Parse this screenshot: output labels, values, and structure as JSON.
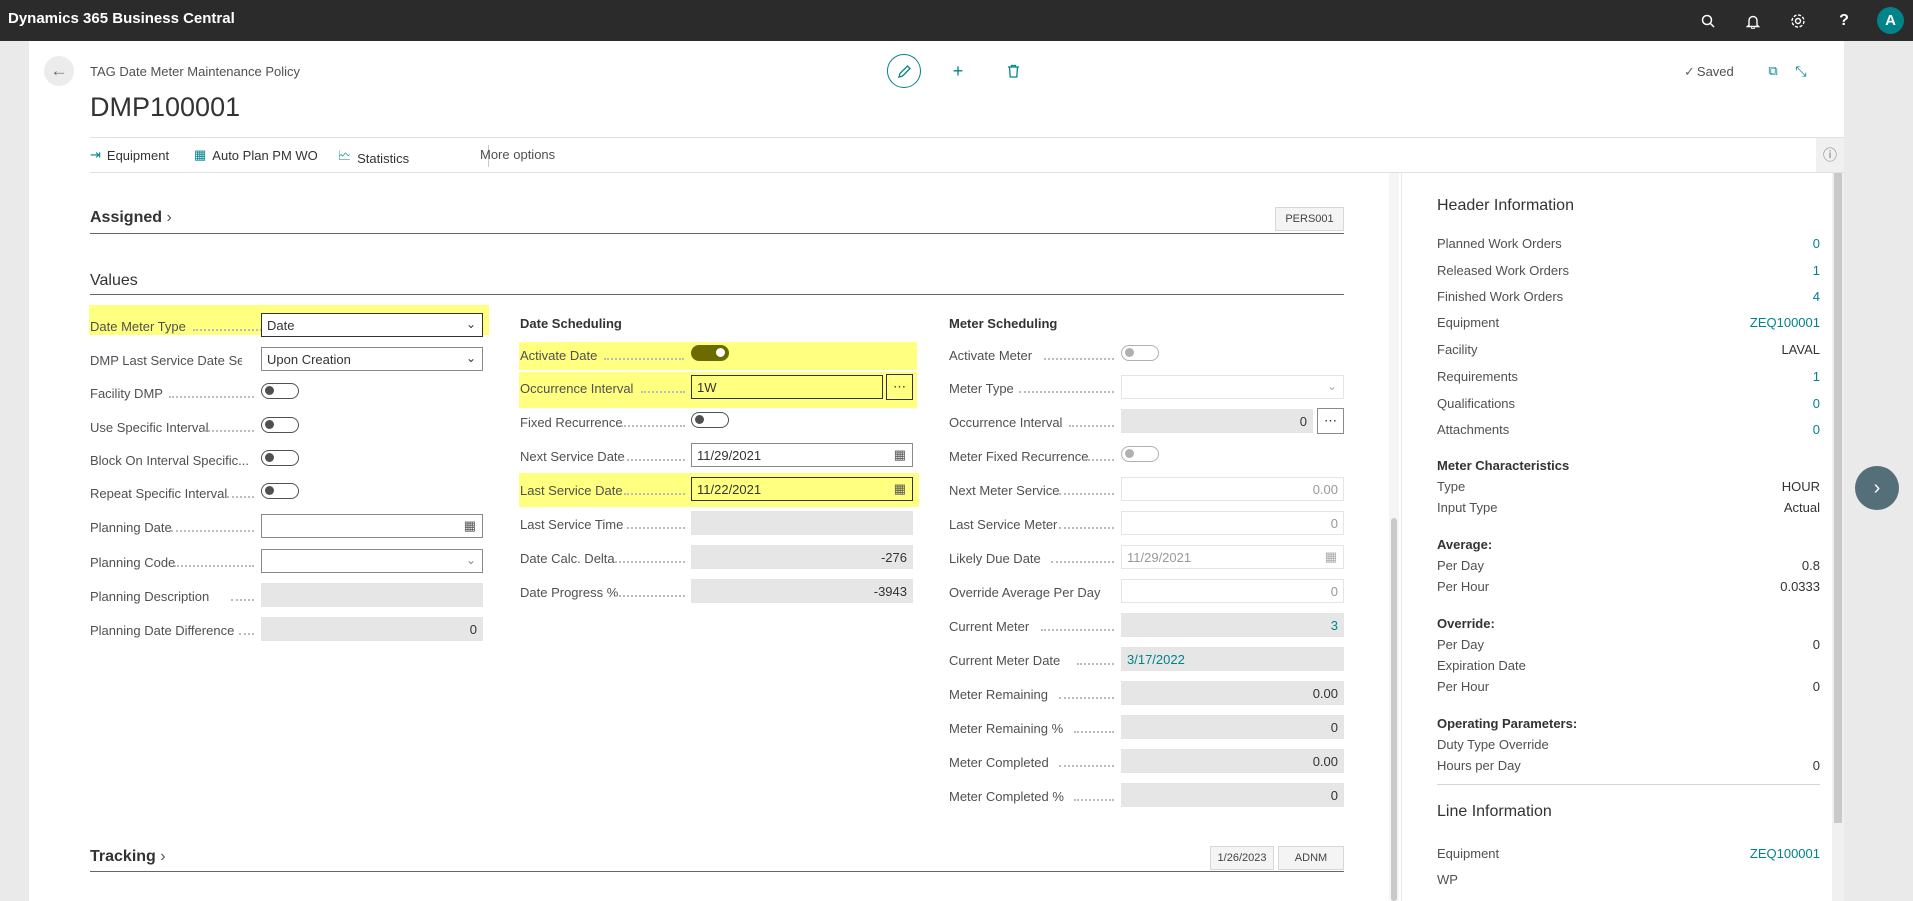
{
  "app": {
    "title": "Dynamics 365 Business Central",
    "avatar_initial": "A"
  },
  "header": {
    "breadcrumb": "TAG Date Meter Maintenance Policy",
    "title": "DMP100001",
    "status": "Saved"
  },
  "actions": {
    "equipment": "Equipment",
    "auto_plan": "Auto Plan PM WO",
    "statistics": "Statistics",
    "more": "More options"
  },
  "assigned": {
    "title": "Assigned",
    "chip": "PERS001"
  },
  "values": {
    "title": "Values",
    "left": {
      "date_meter_type": {
        "label": "Date Meter Type",
        "value": "Date"
      },
      "dmp_last_service": {
        "label": "DMP Last Service Date Se...",
        "value": "Upon Creation"
      },
      "facility_dmp": {
        "label": "Facility DMP",
        "on": false
      },
      "use_specific_interval": {
        "label": "Use Specific Interval",
        "on": false
      },
      "block_on_interval": {
        "label": "Block On Interval Specific...",
        "on": false
      },
      "repeat_specific_interval": {
        "label": "Repeat Specific Interval",
        "on": false
      },
      "planning_date": {
        "label": "Planning Date",
        "value": ""
      },
      "planning_code": {
        "label": "Planning Code",
        "value": ""
      },
      "planning_description": {
        "label": "Planning Description",
        "value": ""
      },
      "planning_date_difference": {
        "label": "Planning Date Difference",
        "value": "0"
      }
    },
    "date_scheduling": {
      "title": "Date Scheduling",
      "activate_date": {
        "label": "Activate Date",
        "on": true
      },
      "occurrence_interval": {
        "label": "Occurrence Interval",
        "value": "1W"
      },
      "fixed_recurrence": {
        "label": "Fixed Recurrence",
        "on": false
      },
      "next_service_date": {
        "label": "Next Service Date",
        "value": "11/29/2021"
      },
      "last_service_date": {
        "label": "Last Service Date",
        "value": "11/22/2021"
      },
      "last_service_time": {
        "label": "Last Service Time",
        "value": ""
      },
      "date_calc_delta": {
        "label": "Date Calc. Delta",
        "value": "-276"
      },
      "date_progress": {
        "label": "Date Progress %",
        "value": "-3943"
      }
    },
    "meter_scheduling": {
      "title": "Meter Scheduling",
      "activate_meter": {
        "label": "Activate Meter",
        "on": false
      },
      "meter_type": {
        "label": "Meter Type",
        "value": ""
      },
      "occurrence_interval": {
        "label": "Occurrence Interval",
        "value": "0"
      },
      "meter_fixed_recurrence": {
        "label": "Meter Fixed Recurrence",
        "on": false
      },
      "next_meter_service": {
        "label": "Next Meter Service",
        "value": "0.00"
      },
      "last_service_meter": {
        "label": "Last Service Meter",
        "value": "0"
      },
      "likely_due_date": {
        "label": "Likely Due Date",
        "value": "11/29/2021"
      },
      "override_average": {
        "label": "Override Average Per Day",
        "value": "0"
      },
      "current_meter": {
        "label": "Current Meter",
        "value": "3"
      },
      "current_meter_date": {
        "label": "Current Meter Date",
        "value": "3/17/2022"
      },
      "meter_remaining": {
        "label": "Meter Remaining",
        "value": "0.00"
      },
      "meter_remaining_pct": {
        "label": "Meter Remaining %",
        "value": "0"
      },
      "meter_completed": {
        "label": "Meter Completed",
        "value": "0.00"
      },
      "meter_completed_pct": {
        "label": "Meter Completed %",
        "value": "0"
      }
    }
  },
  "tracking": {
    "title": "Tracking",
    "chip_date": "1/26/2023",
    "chip_user": "ADNM"
  },
  "factbox": {
    "header_title": "Header Information",
    "rows": [
      {
        "label": "Planned Work Orders",
        "value": "0"
      },
      {
        "label": "Released Work Orders",
        "value": "1"
      },
      {
        "label": "Finished Work Orders",
        "value": "4"
      },
      {
        "label": "Equipment",
        "value": "ZEQ100001"
      },
      {
        "label": "Facility",
        "value": "LAVAL"
      },
      {
        "label": "Requirements",
        "value": "1"
      },
      {
        "label": "Qualifications",
        "value": "0"
      },
      {
        "label": "Attachments",
        "value": "0"
      }
    ],
    "meter_char_title": "Meter Characteristics",
    "type_label": "Type",
    "type_value": "HOUR",
    "input_type_label": "Input Type",
    "input_type_value": "Actual",
    "average_title": "Average:",
    "avg_per_day_label": "Per Day",
    "avg_per_day_value": "0.8",
    "avg_per_hour_label": "Per Hour",
    "avg_per_hour_value": "0.0333",
    "override_title": "Override:",
    "ov_per_day_label": "Per Day",
    "ov_per_day_value": "0",
    "ov_exp_label": "Expiration Date",
    "ov_per_hour_label": "Per Hour",
    "ov_per_hour_value": "0",
    "operating_title": "Operating Parameters:",
    "duty_label": "Duty Type Override",
    "hours_label": "Hours per Day",
    "hours_value": "0",
    "line_title": "Line Information",
    "line_equipment_label": "Equipment",
    "line_equipment_value": "ZEQ100001",
    "line_wp_label": "WP"
  },
  "colors": {
    "accent": "#00838a",
    "highlight": "#ffff80",
    "topbar": "#2b2b2b"
  }
}
